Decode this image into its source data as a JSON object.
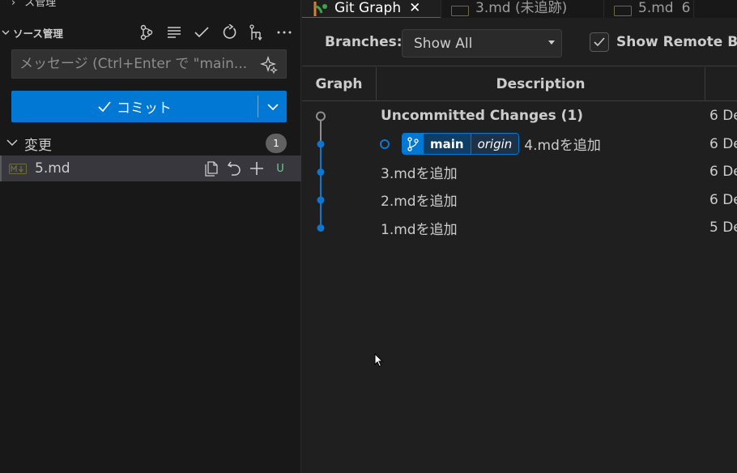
{
  "sidebar": {
    "clipped_title": "ス管理",
    "scm_title": "ソース管理",
    "commit_message_placeholder": "メッセージ (Ctrl+Enter で \"main...",
    "commit_button_label": "コミット",
    "changes_label": "変更",
    "changes_count": "1",
    "files": [
      {
        "name": "5.md",
        "status": "U"
      }
    ]
  },
  "tabs": [
    {
      "label": "Git Graph",
      "active": true
    },
    {
      "label": "3.md (未追跡)",
      "active": false
    },
    {
      "label": "5.md",
      "active": false
    },
    {
      "label": "6",
      "active": false
    }
  ],
  "controls": {
    "branches_label": "Branches:",
    "branches_value": "Show All",
    "show_remote_label": "Show Remote Bra",
    "show_remote_checked": true
  },
  "table": {
    "headers": {
      "graph": "Graph",
      "description": "Description",
      "date": ""
    },
    "rows": [
      {
        "description": "Uncommitted Changes (1)",
        "date": "6 De",
        "bold": true
      },
      {
        "description": "4.mdを追加",
        "date": "6 De",
        "branch": "main",
        "remote": "origin"
      },
      {
        "description": "3.mdを追加",
        "date": "6 De"
      },
      {
        "description": "2.mdを追加",
        "date": "6 De"
      },
      {
        "description": "1.mdを追加",
        "date": "5 De"
      }
    ]
  },
  "colors": {
    "accent": "#0078d4",
    "graph_line": "#0e77d1",
    "uncommitted": "#8f8f8f",
    "untracked": "#73c991"
  }
}
